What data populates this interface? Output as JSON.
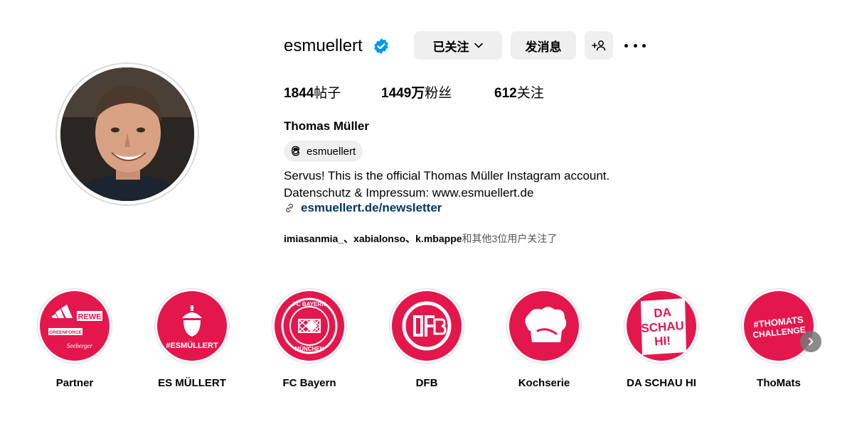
{
  "profile": {
    "username": "esmuellert",
    "following_button_label": "已关注",
    "message_button_label": "发消息",
    "full_name": "Thomas Müller",
    "threads_handle": "esmuellert",
    "bio_lines": [
      "Servus! This is the official Thomas Müller Instagram account.",
      "Datenschutz & Impressum: www.esmuellert.de"
    ],
    "link": "esmuellert.de/newsletter",
    "followed_by": {
      "names": "imiasanmia_、xabialonso、k.mbappe",
      "suffix": "和其他3位用户关注了"
    }
  },
  "stats": {
    "posts_count": "1844",
    "posts_label": "帖子",
    "followers_count": "1449万",
    "followers_label": "粉丝",
    "following_count": "612",
    "following_label": "关注"
  },
  "highlights": [
    {
      "label": "Partner",
      "inner": [
        "REWE",
        "GREENFORCE",
        "Seeberger"
      ]
    },
    {
      "label": "ES MÜLLERT",
      "inner": [
        "#ESMÜLLERT"
      ]
    },
    {
      "label": "FC Bayern",
      "inner": [
        "FC BAYERN",
        "MÜNCHEN"
      ]
    },
    {
      "label": "DFB",
      "inner": []
    },
    {
      "label": "Kochserie",
      "inner": []
    },
    {
      "label": "DA SCHAU HI",
      "inner": [
        "DA",
        "SCHAU",
        "HI!"
      ]
    },
    {
      "label": "ThoMats",
      "inner": [
        "#THOMATS",
        "CHALLENGE"
      ]
    }
  ],
  "colors": {
    "highlight_red": "#e4174d",
    "verified_blue": "#0095f6",
    "link_blue": "#00376b",
    "button_gray": "#efefef"
  },
  "icons": [
    "verified-badge-icon",
    "chevron-down-icon",
    "add-user-icon",
    "more-icon",
    "threads-icon",
    "link-icon",
    "next-arrow-icon"
  ]
}
